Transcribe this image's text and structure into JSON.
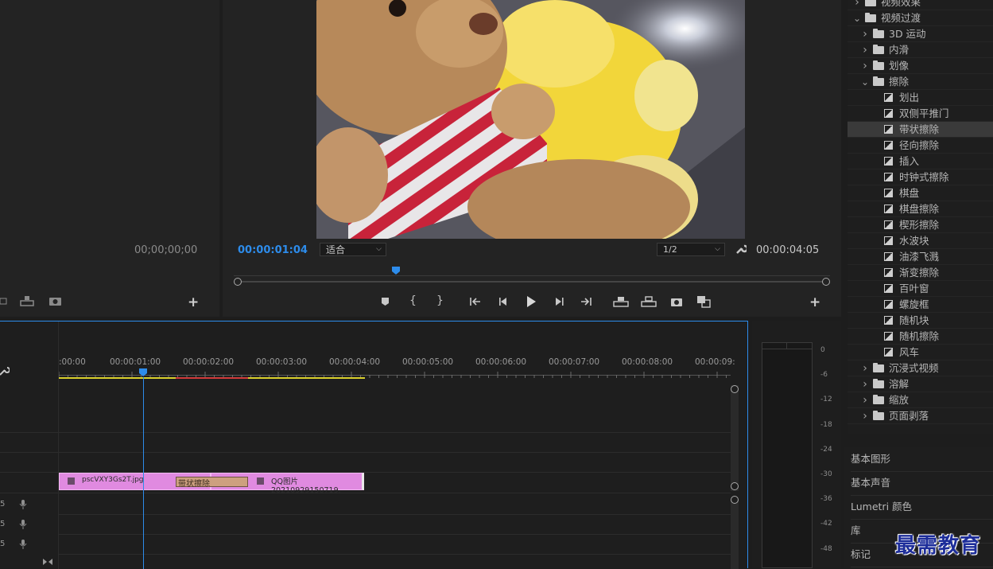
{
  "source_monitor": {
    "timecode": "00;00;00;00",
    "icons": [
      "export-frame-icon",
      "insert-icon",
      "camera-icon",
      "add-icon"
    ]
  },
  "program_monitor": {
    "current_time": "00:00:01:04",
    "fit_label": "适合",
    "resolution": "1/2",
    "duration": "00:00:04:05",
    "accent_color": "#2d8ceb"
  },
  "effects": {
    "items": [
      {
        "label": "视频效果",
        "level": 0,
        "type": "folder",
        "open": false
      },
      {
        "label": "视频过渡",
        "level": 0,
        "type": "folder",
        "open": true
      },
      {
        "label": "3D 运动",
        "level": 1,
        "type": "folder",
        "open": false
      },
      {
        "label": "内滑",
        "level": 1,
        "type": "folder",
        "open": false
      },
      {
        "label": "划像",
        "level": 1,
        "type": "folder",
        "open": false
      },
      {
        "label": "擦除",
        "level": 1,
        "type": "folder",
        "open": true
      },
      {
        "label": "划出",
        "level": 2,
        "type": "effect"
      },
      {
        "label": "双侧平推门",
        "level": 2,
        "type": "effect"
      },
      {
        "label": "带状擦除",
        "level": 2,
        "type": "effect",
        "selected": true
      },
      {
        "label": "径向擦除",
        "level": 2,
        "type": "effect"
      },
      {
        "label": "插入",
        "level": 2,
        "type": "effect"
      },
      {
        "label": "时钟式擦除",
        "level": 2,
        "type": "effect"
      },
      {
        "label": "棋盘",
        "level": 2,
        "type": "effect"
      },
      {
        "label": "棋盘擦除",
        "level": 2,
        "type": "effect"
      },
      {
        "label": "楔形擦除",
        "level": 2,
        "type": "effect"
      },
      {
        "label": "水波块",
        "level": 2,
        "type": "effect"
      },
      {
        "label": "油漆飞溅",
        "level": 2,
        "type": "effect"
      },
      {
        "label": "渐变擦除",
        "level": 2,
        "type": "effect"
      },
      {
        "label": "百叶窗",
        "level": 2,
        "type": "effect"
      },
      {
        "label": "螺旋框",
        "level": 2,
        "type": "effect"
      },
      {
        "label": "随机块",
        "level": 2,
        "type": "effect"
      },
      {
        "label": "随机擦除",
        "level": 2,
        "type": "effect"
      },
      {
        "label": "风车",
        "level": 2,
        "type": "effect"
      },
      {
        "label": "沉浸式视频",
        "level": 1,
        "type": "folder",
        "open": false
      },
      {
        "label": "溶解",
        "level": 1,
        "type": "folder",
        "open": false
      },
      {
        "label": "缩放",
        "level": 1,
        "type": "folder",
        "open": false
      },
      {
        "label": "页面剥落",
        "level": 1,
        "type": "folder",
        "open": false
      }
    ]
  },
  "side_panels": [
    "基本图形",
    "基本声音",
    "Lumetri 颜色",
    "库",
    "标记"
  ],
  "timeline": {
    "ruler": [
      ":00:00",
      "00:00:01:00",
      "00:00:02:00",
      "00:00:03:00",
      "00:00:04:00",
      "00:00:05:00",
      "00:00:06:00",
      "00:00:07:00",
      "00:00:08:00",
      "00:00:09:"
    ],
    "clip1": "pscVXY3Gs2T.jpg",
    "transition": "带状擦除",
    "clip2": "QQ图片20210929150719.",
    "track_labels": [
      "5",
      "5",
      "5"
    ]
  },
  "audio_meter": {
    "scale": [
      "0",
      "-6",
      "-12",
      "-18",
      "-24",
      "-30",
      "-36",
      "-42",
      "-48"
    ]
  },
  "watermark": "最需教育"
}
